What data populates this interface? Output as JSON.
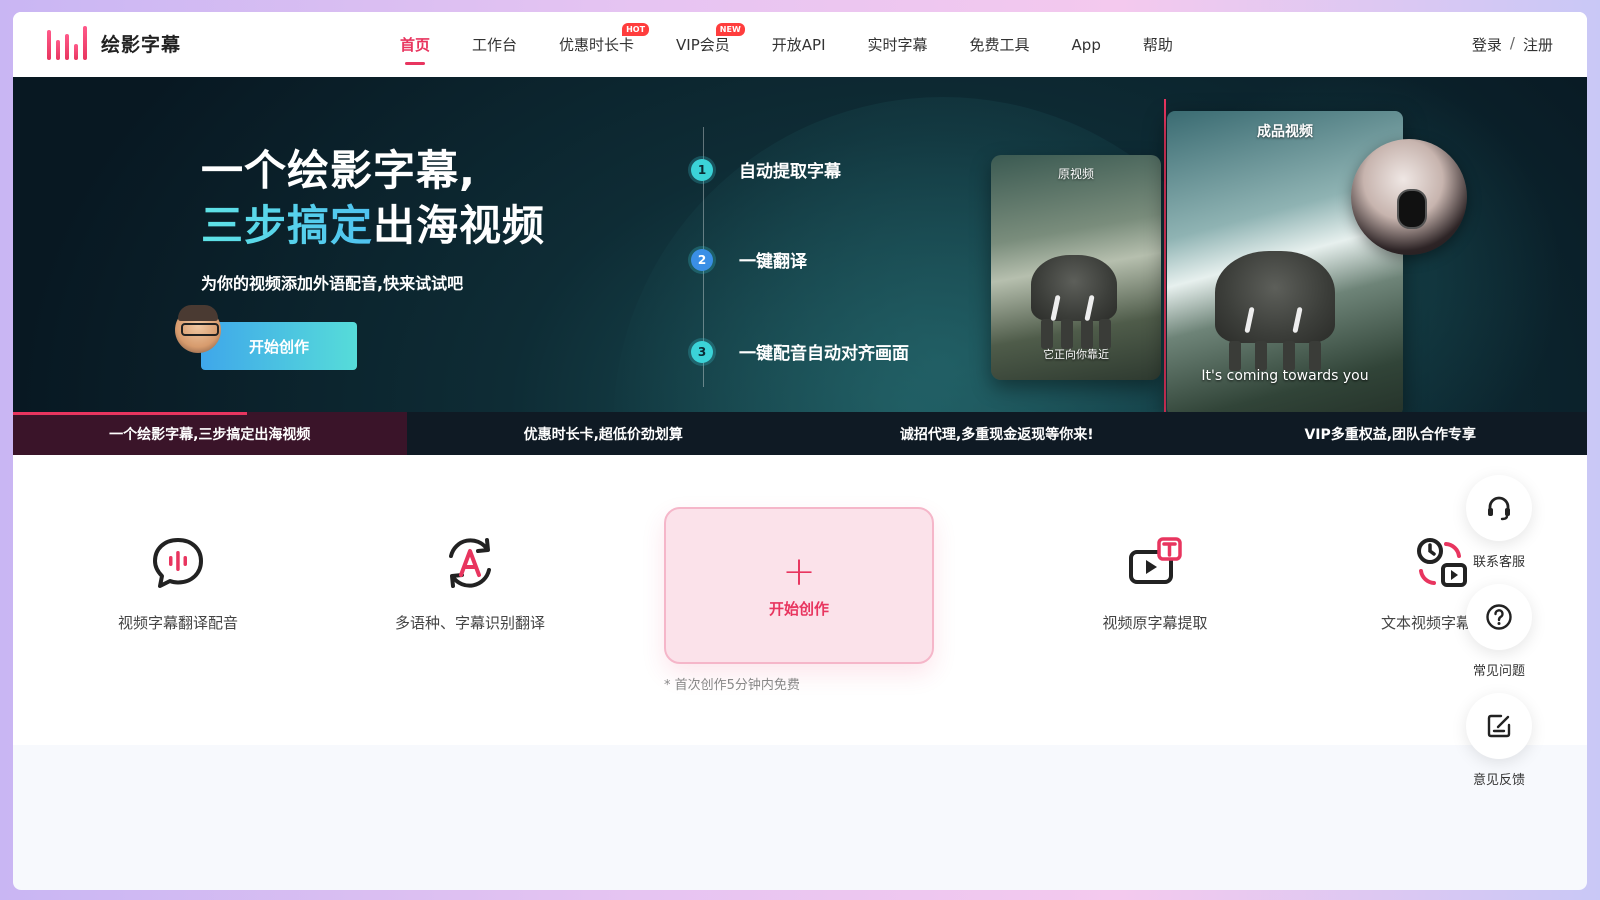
{
  "brand": {
    "name": "绘影字幕"
  },
  "nav": {
    "items": [
      {
        "label": "首页",
        "active": true,
        "badge": ""
      },
      {
        "label": "工作台",
        "active": false,
        "badge": ""
      },
      {
        "label": "优惠时长卡",
        "active": false,
        "badge": "HOT"
      },
      {
        "label": "VIP会员",
        "active": false,
        "badge": "NEW"
      },
      {
        "label": "开放API",
        "active": false,
        "badge": ""
      },
      {
        "label": "实时字幕",
        "active": false,
        "badge": ""
      },
      {
        "label": "免费工具",
        "active": false,
        "badge": ""
      },
      {
        "label": "App",
        "active": false,
        "badge": ""
      },
      {
        "label": "帮助",
        "active": false,
        "badge": ""
      }
    ]
  },
  "auth": {
    "login": "登录",
    "separator": "/",
    "register": "注册"
  },
  "hero": {
    "title_line1": "一个绘影字幕,",
    "title_line2_highlight": "三步搞定",
    "title_line2_rest": "出海视频",
    "subtitle": "为你的视频添加外语配音,快来试试吧",
    "cta": "开始创作",
    "steps": [
      {
        "num": "1",
        "text": "自动提取字幕"
      },
      {
        "num": "2",
        "text": "一键翻译"
      },
      {
        "num": "3",
        "text": "一键配音自动对齐画面"
      }
    ],
    "preview": {
      "original_label": "原视频",
      "original_caption": "它正向你靠近",
      "final_label": "成品视频",
      "final_caption": "It's coming towards you"
    }
  },
  "tabstrip": {
    "items": [
      {
        "label": "一个绘影字幕,三步搞定出海视频",
        "active": true
      },
      {
        "label": "优惠时长卡,超低价劲划算",
        "active": false
      },
      {
        "label": "诚招代理,多重现金返现等你来!",
        "active": false
      },
      {
        "label": "VIP多重权益,团队合作专享",
        "active": false
      }
    ]
  },
  "features": {
    "items": [
      {
        "label": "视频字幕翻译配音",
        "icon": "speech-waveform-icon"
      },
      {
        "label": "多语种、字幕识别翻译",
        "icon": "language-cycle-icon"
      },
      {
        "label": "视频原字幕提取",
        "icon": "video-text-extract-icon"
      },
      {
        "label": "文本视频字幕匹配",
        "icon": "text-video-match-icon"
      }
    ],
    "create": {
      "label": "开始创作",
      "note": "* 首次创作5分钟内免费"
    }
  },
  "side": {
    "items": [
      {
        "label": "联系客服",
        "icon": "headset-icon"
      },
      {
        "label": "常见问题",
        "icon": "question-icon"
      },
      {
        "label": "意见反馈",
        "icon": "feedback-edit-icon"
      }
    ]
  },
  "colors": {
    "accent": "#e8355f",
    "hero_bg": "#0e2c35",
    "cta_start": "#3fa7ea",
    "cta_end": "#56dcd9"
  }
}
